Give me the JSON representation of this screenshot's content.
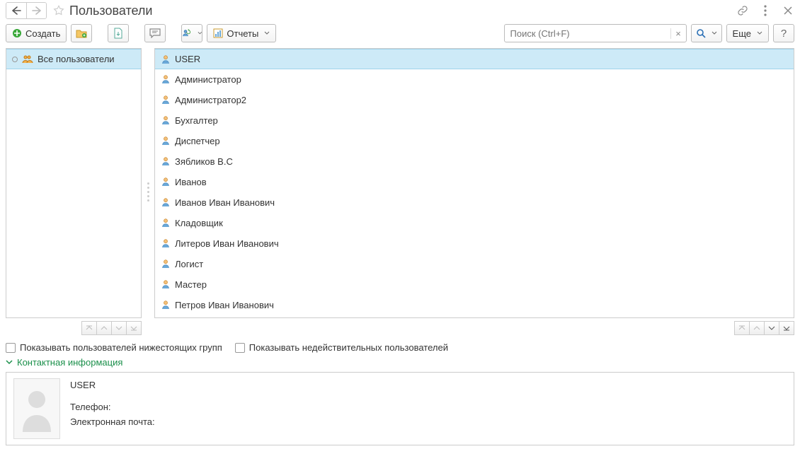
{
  "header": {
    "title": "Пользователи"
  },
  "toolbar": {
    "create_label": "Создать",
    "reports_label": "Отчеты",
    "search_placeholder": "Поиск (Ctrl+F)",
    "more_label": "Еще"
  },
  "tree": {
    "root_label": "Все пользователи"
  },
  "users": [
    "USER",
    "Администратор",
    "Администратор2",
    "Бухгалтер",
    "Диспетчер",
    "Зябликов В.С",
    "Иванов",
    "Иванов Иван Иванович",
    "Кладовщик",
    "Литеров Иван Иванович",
    "Логист",
    "Мастер",
    "Петров Иван Иванович"
  ],
  "checkboxes": {
    "show_subgroups": "Показывать пользователей нижестоящих групп",
    "show_invalid": "Показывать недействительных пользователей"
  },
  "contact": {
    "section_title": "Контактная информация",
    "user_name": "USER",
    "phone_label": "Телефон:",
    "email_label": "Электронная почта:"
  }
}
